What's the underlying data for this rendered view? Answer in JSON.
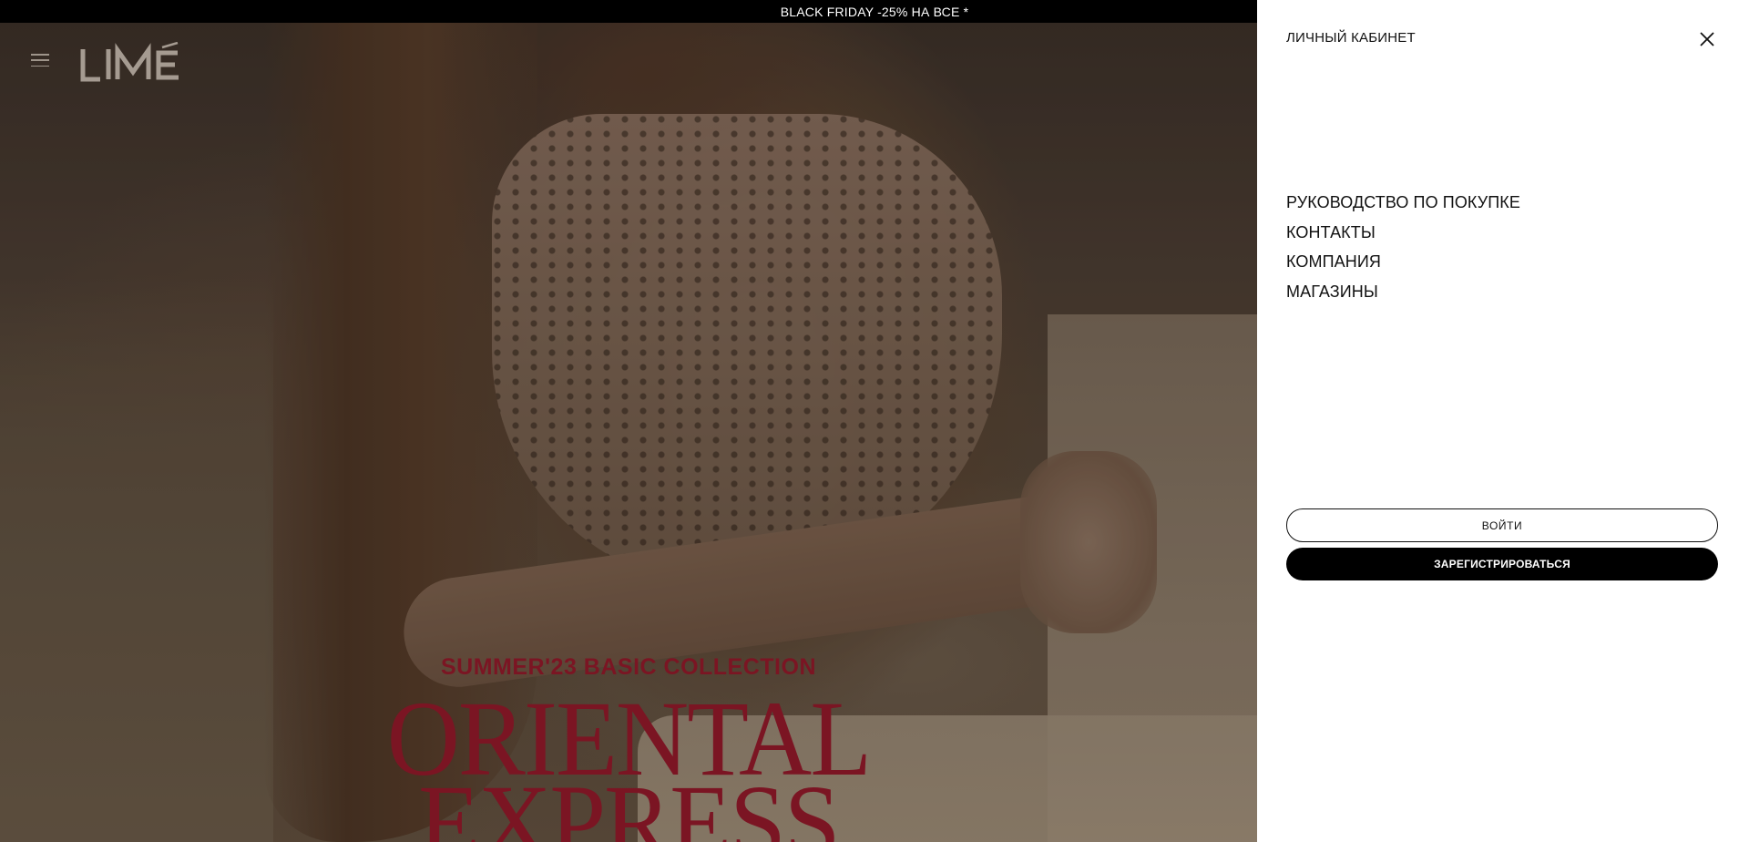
{
  "promo": {
    "text": "BLACK FRIDAY -25% НА ВСЕ *"
  },
  "header": {
    "logo_text": "LIMÉ",
    "menu_icon": "hamburger-menu-icon"
  },
  "hero": {
    "subtitle": "SUMMER'23 BASIC COLLECTION",
    "title_line1": "ORIENTAL",
    "title_line2": "EXPRESS",
    "accent_color": "#7b1523"
  },
  "drawer": {
    "title": "ЛИЧНЫЙ КАБИНЕТ",
    "close_icon": "close-icon",
    "nav_items": [
      "РУКОВОДСТВО ПО ПОКУПКЕ",
      "КОНТАКТЫ",
      "КОМПАНИЯ",
      "МАГАЗИНЫ"
    ],
    "login_label": "ВОЙТИ",
    "register_label": "ЗАРЕГИСТРИРОВАТЬСЯ"
  }
}
